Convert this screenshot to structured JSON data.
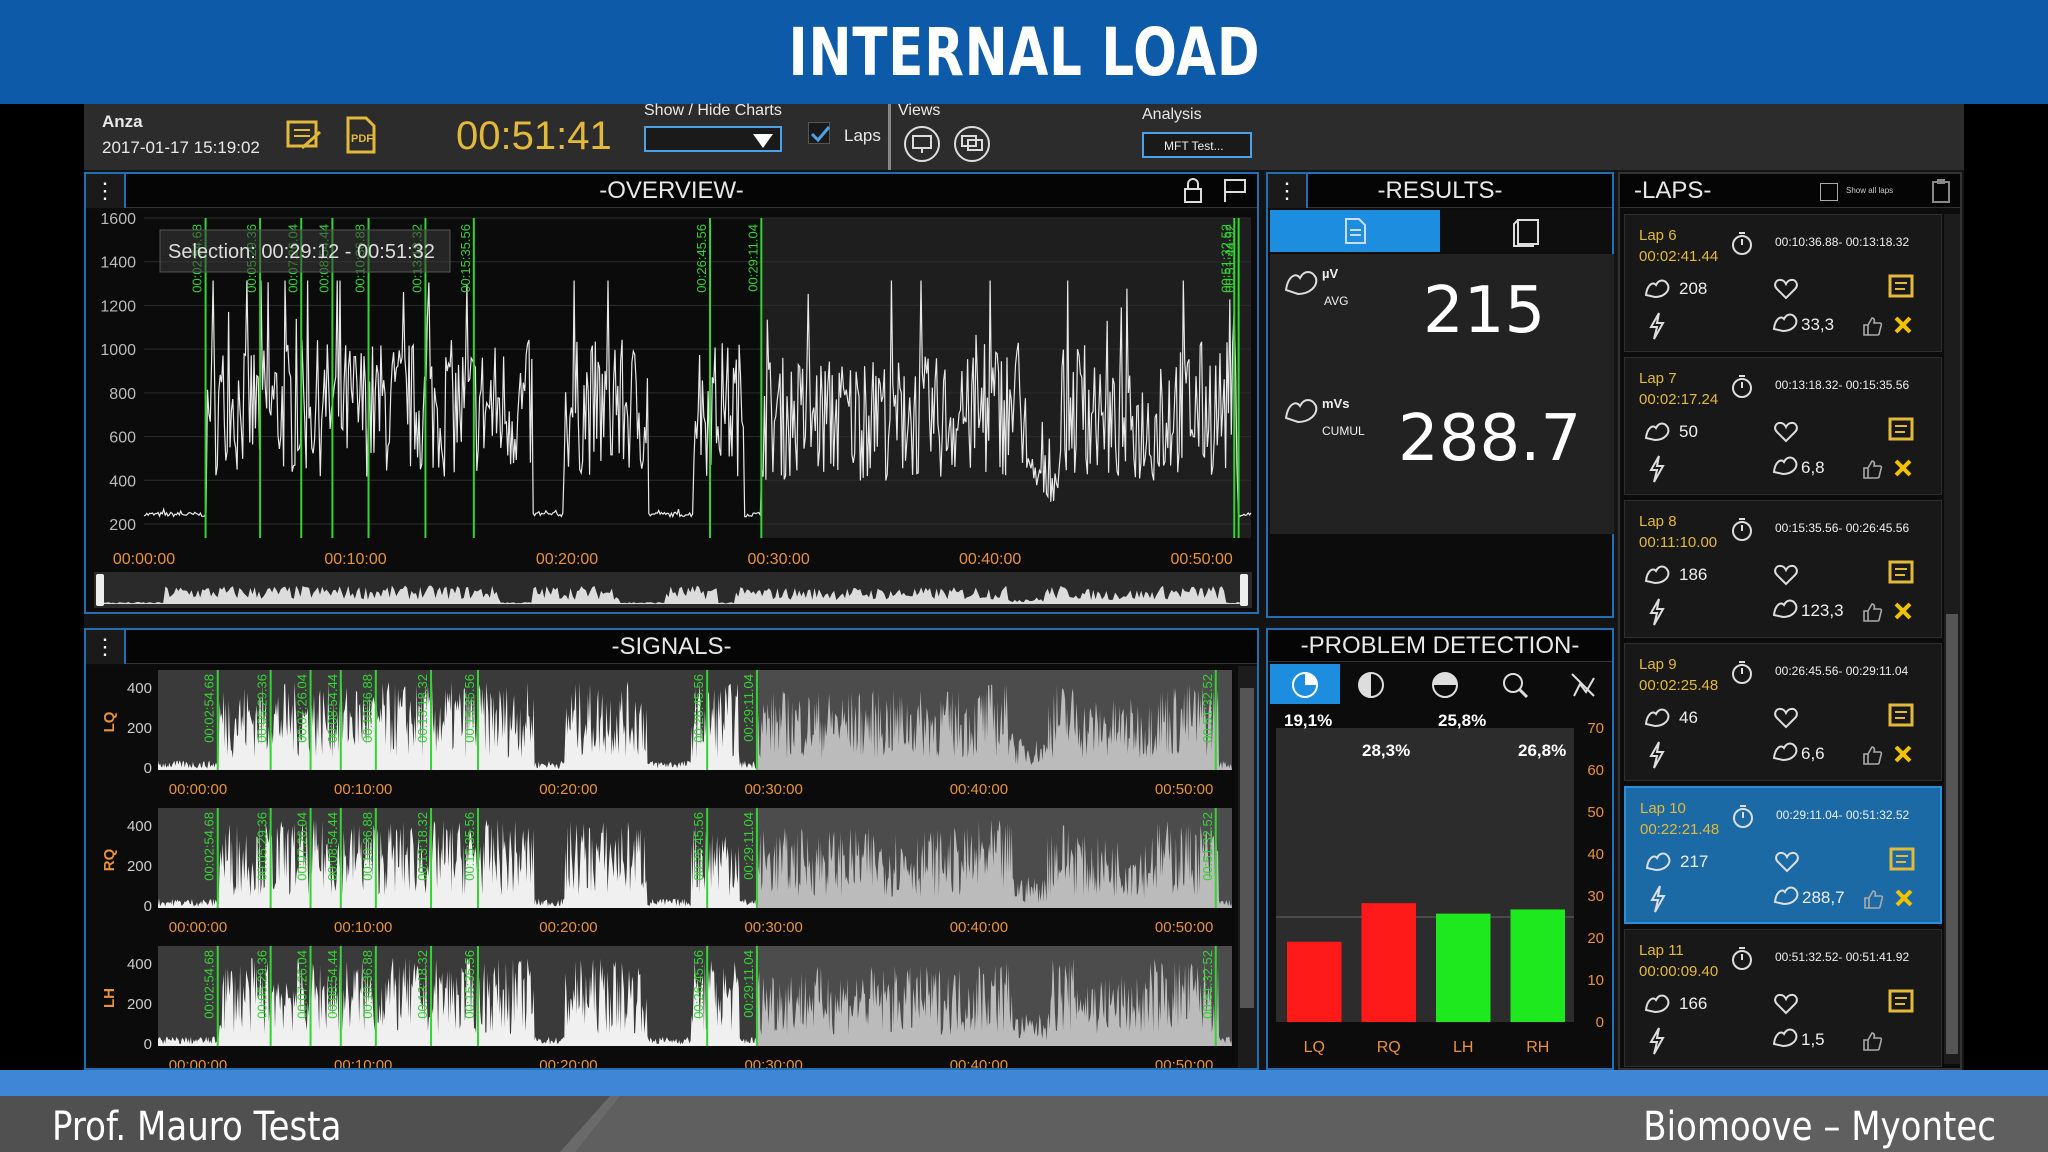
{
  "slide": {
    "title": "INTERNAL LOAD",
    "footer_left": "Prof. Mauro Testa",
    "footer_right": "Biomoove – Myontec"
  },
  "toolbar": {
    "athlete": "Anza",
    "datetime": "2017-01-17 15:19:02",
    "timer": "00:51:41",
    "show_hide_label": "Show / Hide Charts",
    "laps_label": "Laps",
    "laps_checked": true,
    "views_label": "Views",
    "analysis_label": "Analysis",
    "analysis_value": "MFT Test..."
  },
  "overview": {
    "title": "-OVERVIEW-",
    "selection_text": "Selection: 00:29:12 - 00:51:32",
    "y_ticks": [
      "1600",
      "1400",
      "1200",
      "1000",
      "800",
      "600",
      "400",
      "200"
    ],
    "x_ticks": [
      "00:00:00",
      "00:10:00",
      "00:20:00",
      "00:30:00",
      "00:40:00",
      "00:50:00"
    ],
    "marker_labels": [
      "00:02:54.68",
      "00:05:29.36",
      "00:07:26.04",
      "00:08:54.44",
      "00:10:36.88",
      "00:13:18.32",
      "00:15:35.56",
      "00:26:45.56",
      "00:29:11.04",
      "00:51:32.52",
      "00:51:44.92"
    ]
  },
  "results": {
    "title": "-RESULTS-",
    "avg_unit": "µV",
    "avg_label": "AVG",
    "avg_value": "215",
    "cumul_unit": "mVs",
    "cumul_label": "CUMUL",
    "cumul_value": "288.7"
  },
  "signals": {
    "title": "-SIGNALS-",
    "channels": [
      "LQ",
      "RQ",
      "LH"
    ],
    "y_ticks": [
      "400",
      "200",
      "0"
    ],
    "x_ticks": [
      "00:00:00",
      "00:10:00",
      "00:20:00",
      "00:30:00",
      "00:40:00",
      "00:50:00"
    ],
    "marker_labels": [
      "00:02:54.68",
      "00:05:29.36",
      "00:07:26.04",
      "00:08:54.44",
      "00:10:36.88",
      "00:13:18.32",
      "00:15:35.56",
      "00:26:45.56",
      "00:29:11.04",
      "00:51:32.52"
    ]
  },
  "problem_detection": {
    "title": "-PROBLEM DETECTION-",
    "pct_labels": [
      "19,1%",
      "28,3%",
      "25,8%",
      "26,8%"
    ],
    "y_ticks": [
      "70",
      "60",
      "50",
      "40",
      "30",
      "20",
      "10",
      "0"
    ],
    "chart_data": {
      "type": "bar",
      "categories": [
        "LQ",
        "RQ",
        "LH",
        "RH"
      ],
      "values": [
        19.1,
        28.3,
        25.8,
        26.8
      ],
      "colors": [
        "#ff1a1a",
        "#ff1a1a",
        "#1ee81e",
        "#1ee81e"
      ],
      "ylim": [
        0,
        70
      ],
      "reference_line": 25
    }
  },
  "laps": {
    "title": "-LAPS-",
    "show_all_label": "Show all laps",
    "items": [
      {
        "name": "Lap 6",
        "duration": "00:02:41.44",
        "range": "00:10:36.88-   00:13:18.32",
        "avg": "208",
        "cumul": "33,3",
        "selected": false
      },
      {
        "name": "Lap 7",
        "duration": "00:02:17.24",
        "range": "00:13:18.32-   00:15:35.56",
        "avg": "50",
        "cumul": "6,8",
        "selected": false
      },
      {
        "name": "Lap 8",
        "duration": "00:11:10.00",
        "range": "00:15:35.56-   00:26:45.56",
        "avg": "186",
        "cumul": "123,3",
        "selected": false
      },
      {
        "name": "Lap 9",
        "duration": "00:02:25.48",
        "range": "00:26:45.56-   00:29:11.04",
        "avg": "46",
        "cumul": "6,6",
        "selected": false
      },
      {
        "name": "Lap 10",
        "duration": "00:22:21.48",
        "range": "00:29:11.04-   00:51:32.52",
        "avg": "217",
        "cumul": "288,7",
        "selected": true
      },
      {
        "name": "Lap 11",
        "duration": "00:00:09.40",
        "range": "00:51:32.52-   00:51:41.92",
        "avg": "166",
        "cumul": "1,5",
        "selected": false
      }
    ]
  }
}
